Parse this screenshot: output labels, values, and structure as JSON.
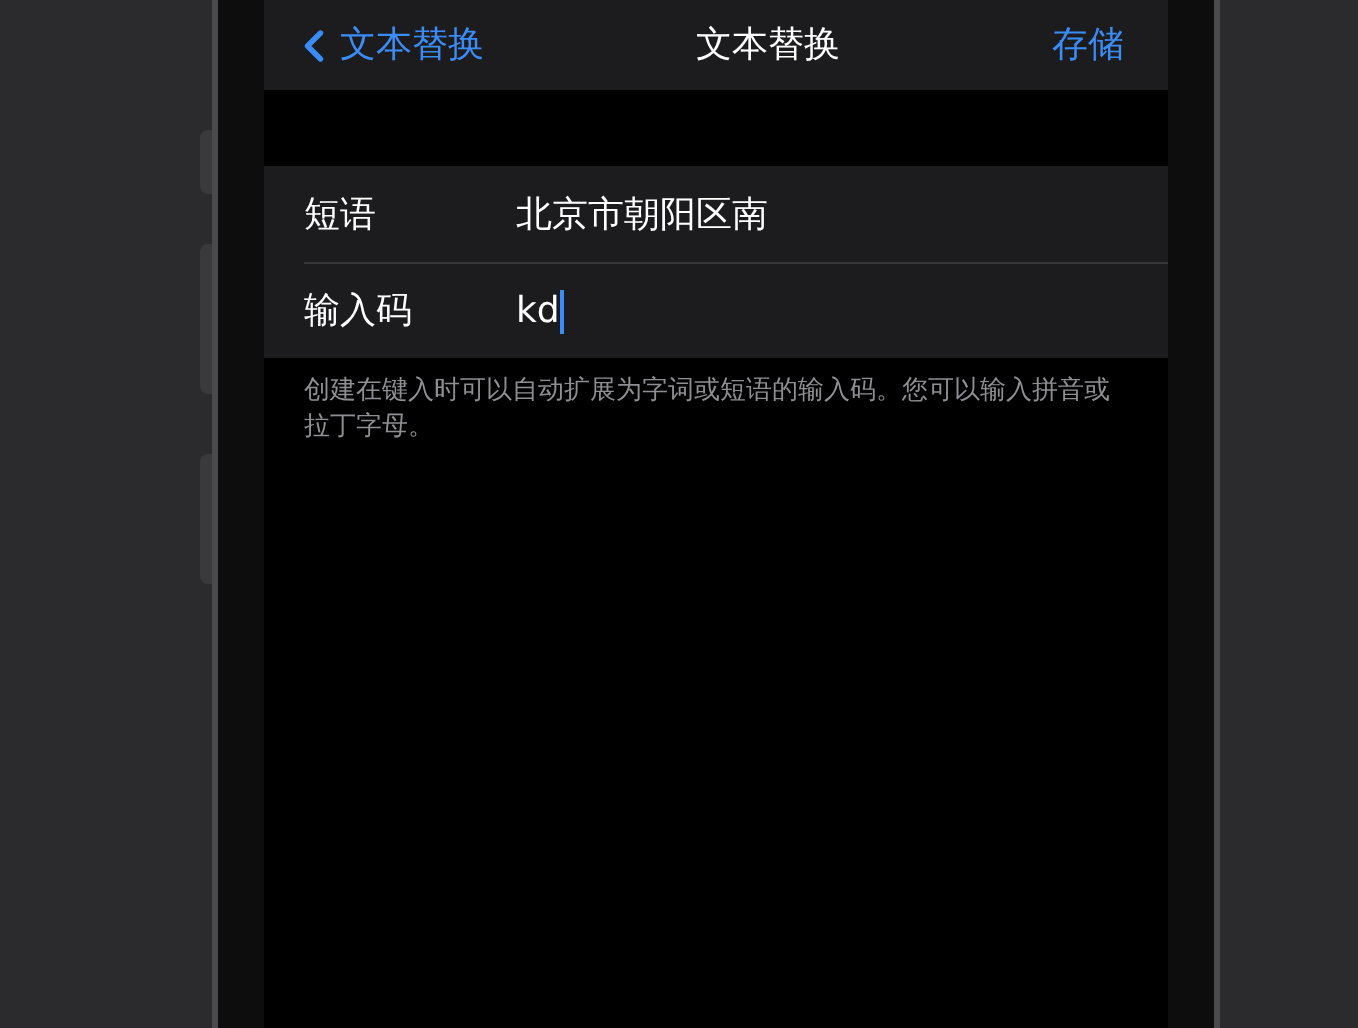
{
  "nav": {
    "back": "文本替换",
    "title": "文本替换",
    "action": "存储"
  },
  "fields": [
    {
      "label": "短语",
      "value": "北京市朝阳区南",
      "focused": false
    },
    {
      "label": "输入码",
      "value": "kd",
      "focused": true
    }
  ],
  "footer": "创建在键入时可以自动扩展为字词或短语的输入码。您可以输入拼音或拉丁字母。"
}
